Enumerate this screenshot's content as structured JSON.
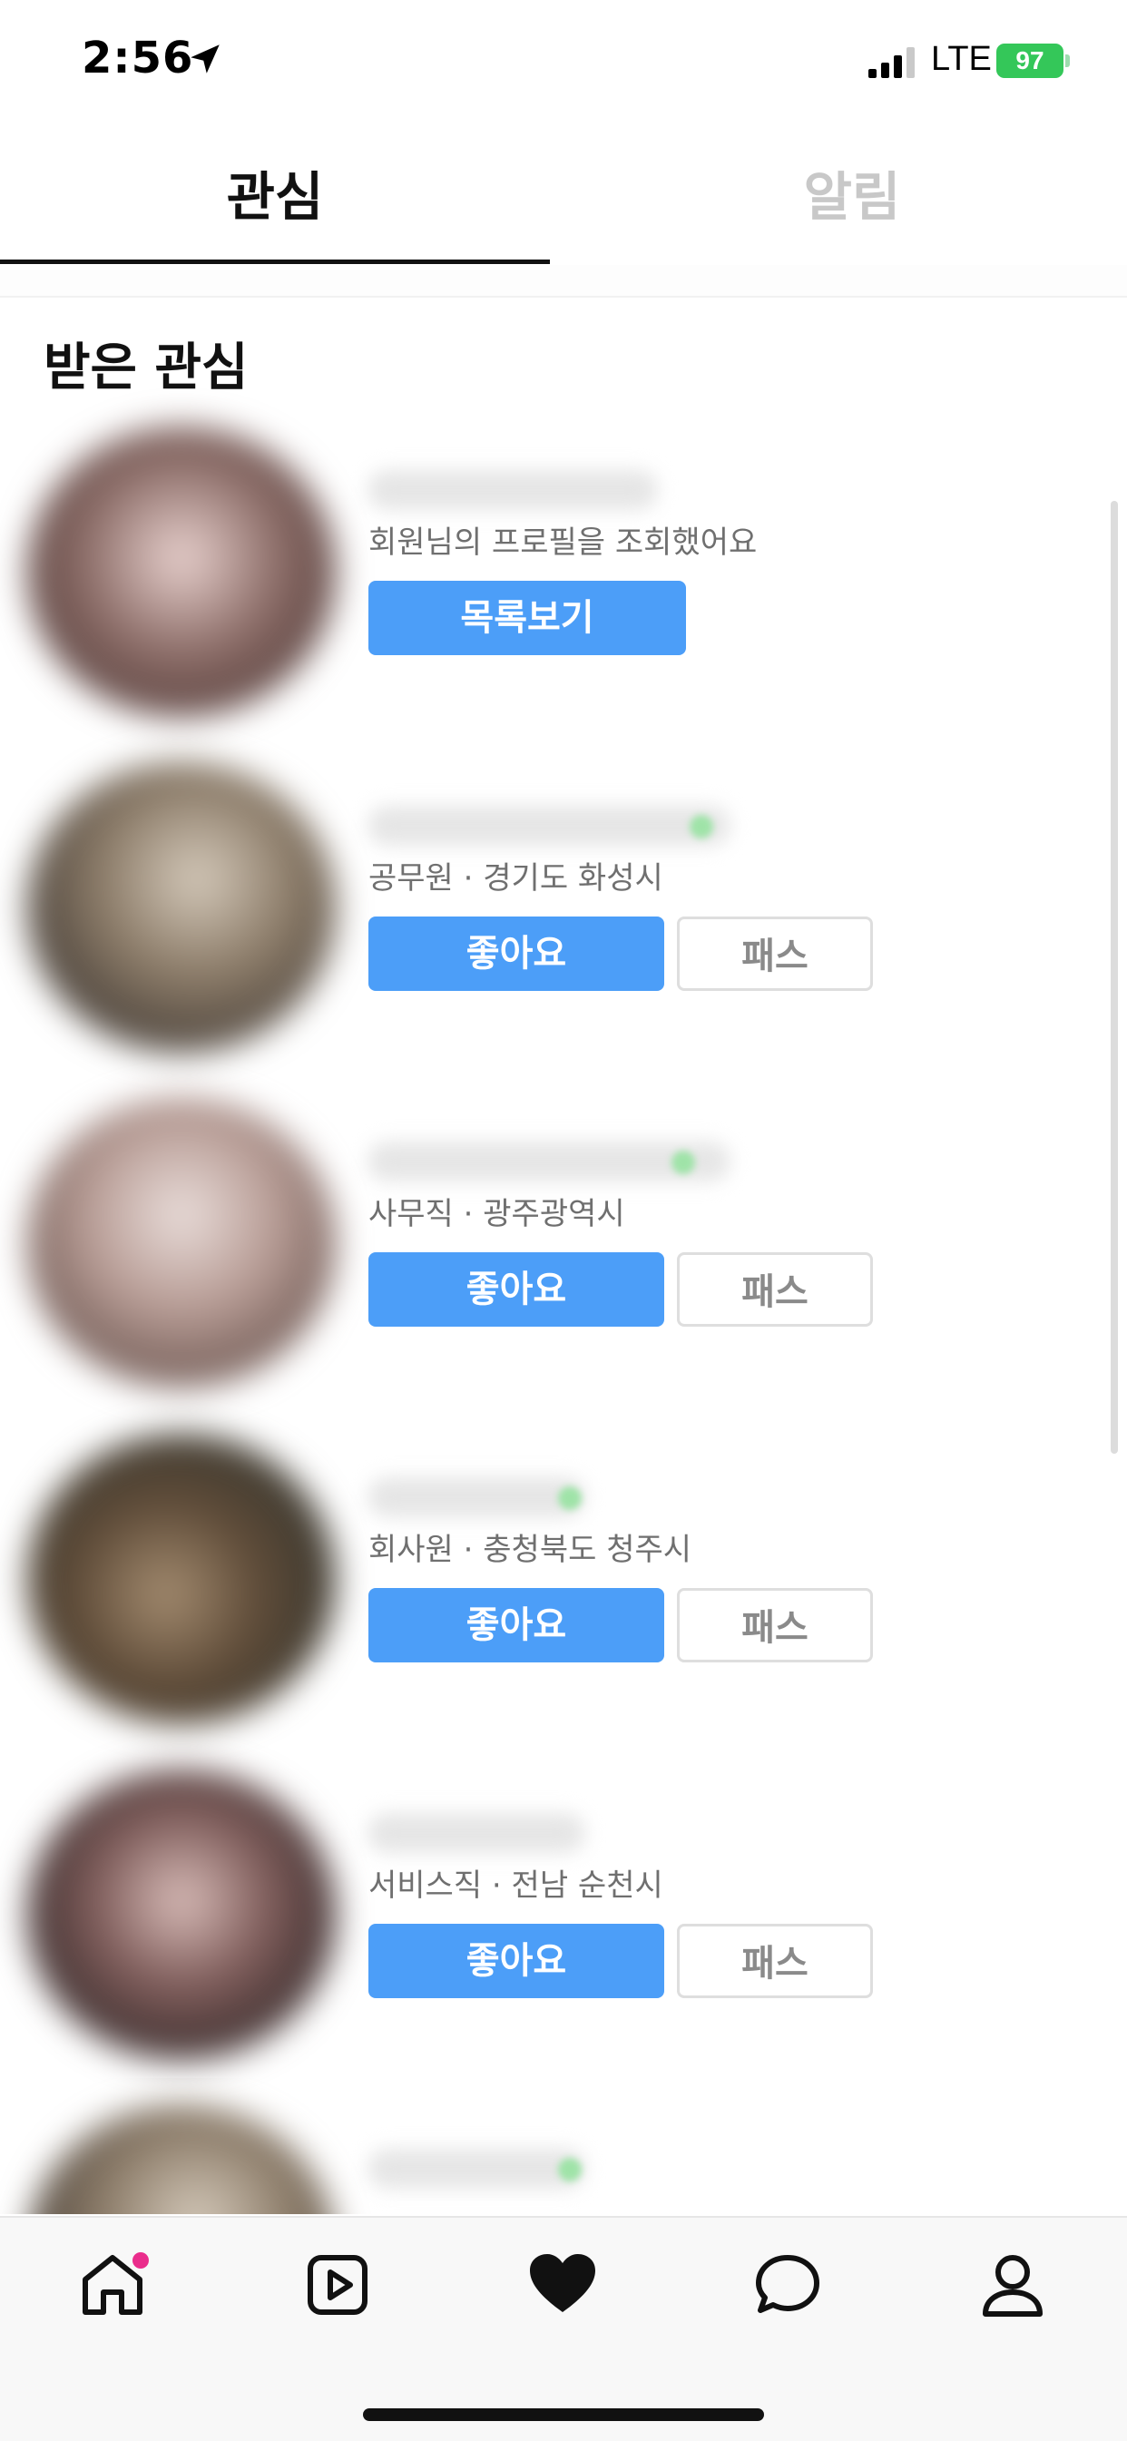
{
  "status_bar": {
    "time": "2:56",
    "network": "LTE",
    "battery": "97"
  },
  "tabs": [
    {
      "label": "관심",
      "active": true
    },
    {
      "label": "알림",
      "active": false
    }
  ],
  "section_title": "받은 관심",
  "items": [
    {
      "description": "회원님의 프로필을 조회했어요",
      "primary_button": "목록보기"
    },
    {
      "description": "공무원 · 경기도 화성시",
      "primary_button": "좋아요",
      "secondary_button": "패스"
    },
    {
      "description": "사무직 · 광주광역시",
      "primary_button": "좋아요",
      "secondary_button": "패스"
    },
    {
      "description": "회사원 · 충청북도 청주시",
      "primary_button": "좋아요",
      "secondary_button": "패스"
    },
    {
      "description": "서비스직 · 전남 순천시",
      "primary_button": "좋아요",
      "secondary_button": "패스"
    }
  ],
  "bottom_nav": [
    {
      "icon": "home-icon",
      "has_badge": true
    },
    {
      "icon": "play-icon"
    },
    {
      "icon": "heart-icon",
      "active": true
    },
    {
      "icon": "chat-icon"
    },
    {
      "icon": "profile-icon"
    }
  ],
  "colors": {
    "accent": "#4c9ef8",
    "badge": "#ea2d8c",
    "battery": "#34c759"
  }
}
